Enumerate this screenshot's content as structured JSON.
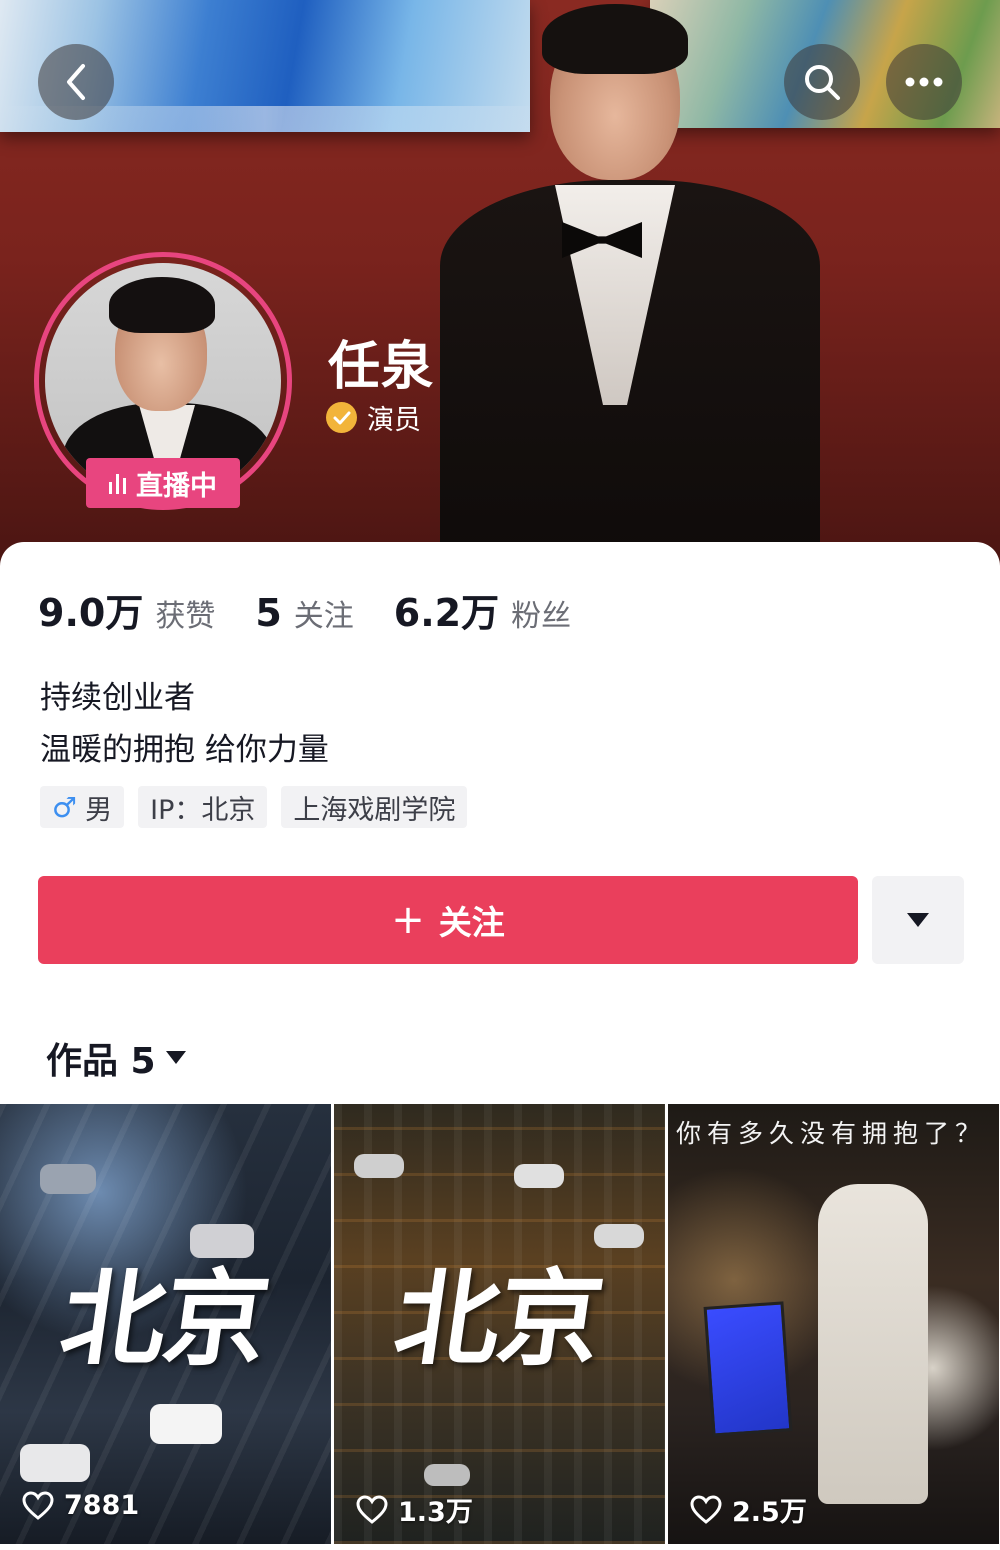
{
  "header": {
    "back_icon": "chevron-left-icon",
    "search_icon": "search-icon",
    "more_icon": "more-dots-icon"
  },
  "profile": {
    "name": "任泉",
    "verify_label": "演员",
    "live_label": "直播中"
  },
  "stats": [
    {
      "value": "9.0万",
      "label": "获赞"
    },
    {
      "value": "5",
      "label": "关注"
    },
    {
      "value": "6.2万",
      "label": "粉丝"
    }
  ],
  "bio": {
    "line1": "持续创业者",
    "line2": "温暖的拥抱 给你力量"
  },
  "tags": {
    "gender": "男",
    "ip": "IP：北京",
    "school": "上海戏剧学院"
  },
  "actions": {
    "follow_plus": "+",
    "follow_label": "关注"
  },
  "works": {
    "label": "作品 5"
  },
  "videos": [
    {
      "title": "北京",
      "likes": "7881"
    },
    {
      "title": "北京",
      "likes": "1.3万"
    },
    {
      "caption": "你有多久没有拥抱了？",
      "likes": "2.5万"
    }
  ],
  "colors": {
    "accent": "#ea3f5c",
    "live": "#e8457f",
    "verify": "#f2b43a"
  }
}
